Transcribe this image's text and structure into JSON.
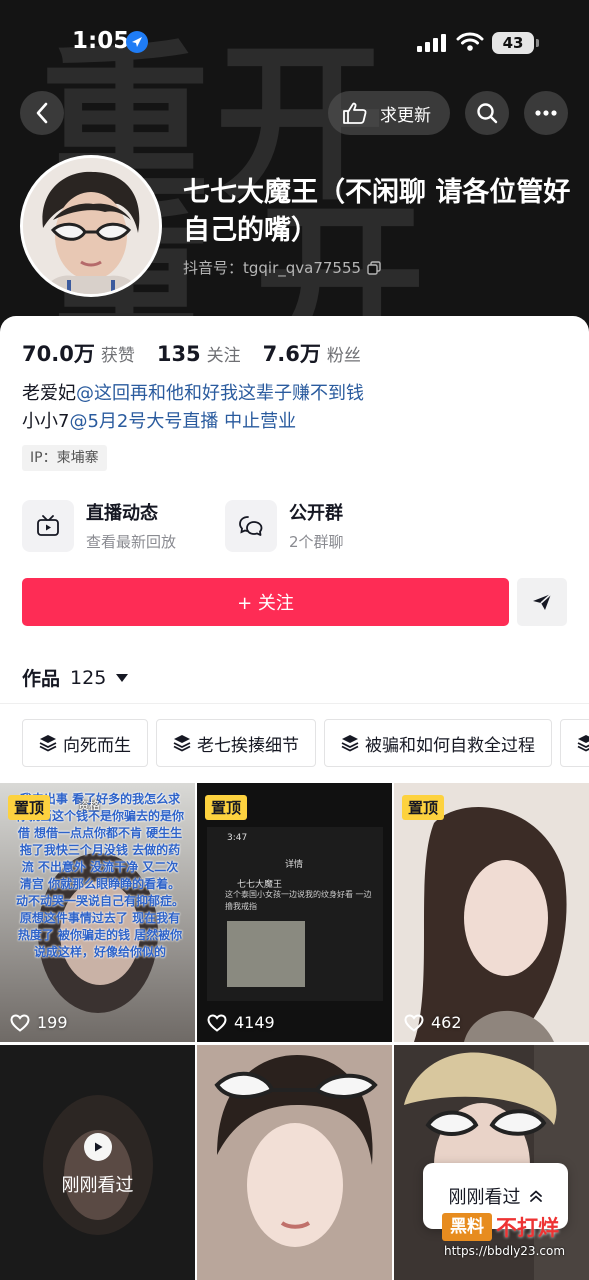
{
  "status_bar": {
    "time": "1:05",
    "battery": "43"
  },
  "header": {
    "update_label": "求更新",
    "background_glyphs": [
      "重",
      "开",
      "重",
      "开"
    ]
  },
  "profile": {
    "nickname": "七七大魔王（不闲聊 请各位管好自己的嘴）",
    "douyin_id": "抖音号：tgqir_qva77555"
  },
  "stats": [
    {
      "value": "70.0万",
      "label": "获赞"
    },
    {
      "value": "135",
      "label": "关注"
    },
    {
      "value": "7.6万",
      "label": "粉丝"
    }
  ],
  "bio": {
    "line1_prefix": "老爱妃",
    "line1_link": "@这回再和他和好我这辈子赚不到钱",
    "line2_prefix": "小小7",
    "line2_link": "@5月2号大号直播 中止营业"
  },
  "ip_tag": "IP：柬埔寨",
  "features": [
    {
      "title": "直播动态",
      "subtitle": "查看最新回放",
      "icon": "tv-icon"
    },
    {
      "title": "公开群",
      "subtitle": "2个群聊",
      "icon": "chat-icon"
    }
  ],
  "follow_label": "+ 关注",
  "works": {
    "label": "作品",
    "count": "125"
  },
  "collections": [
    "向死而生",
    "老七挨揍细节",
    "被骗和如何自救全过程"
  ],
  "videos": [
    {
      "pinned": "置顶",
      "likes": "199",
      "overlay": "我去出事 看了好多的我怎么求你就当这个钱不是你骗去的是你借 想借一点点你都不肯 硬生生拖了我快三个月没钱 去做的药流 不出意外 没流干净 又二次清宫 你就那么眼睁睁的看着。动不动哭一哭说自己有抑郁症。原想这件事情过去了 现在我有热度了 被你骗走的钱 居然被你说成这样，好像给你似的",
      "overlay_small": "资格"
    },
    {
      "pinned": "置顶",
      "likes": "4149",
      "screenshot": {
        "time": "3:47",
        "title": "详情",
        "name": "七七大魔王",
        "text": "这个泰国小女孩一边说我的纹身好看 一边撸我戒指"
      }
    },
    {
      "pinned": "置顶",
      "likes": "462"
    },
    {
      "recently_watched": "刚刚看过"
    },
    {},
    {}
  ],
  "floating_recent": "刚刚看过",
  "watermark": {
    "brand": "黑料",
    "text": "不打烊",
    "url": "https://bbdly23.com"
  }
}
